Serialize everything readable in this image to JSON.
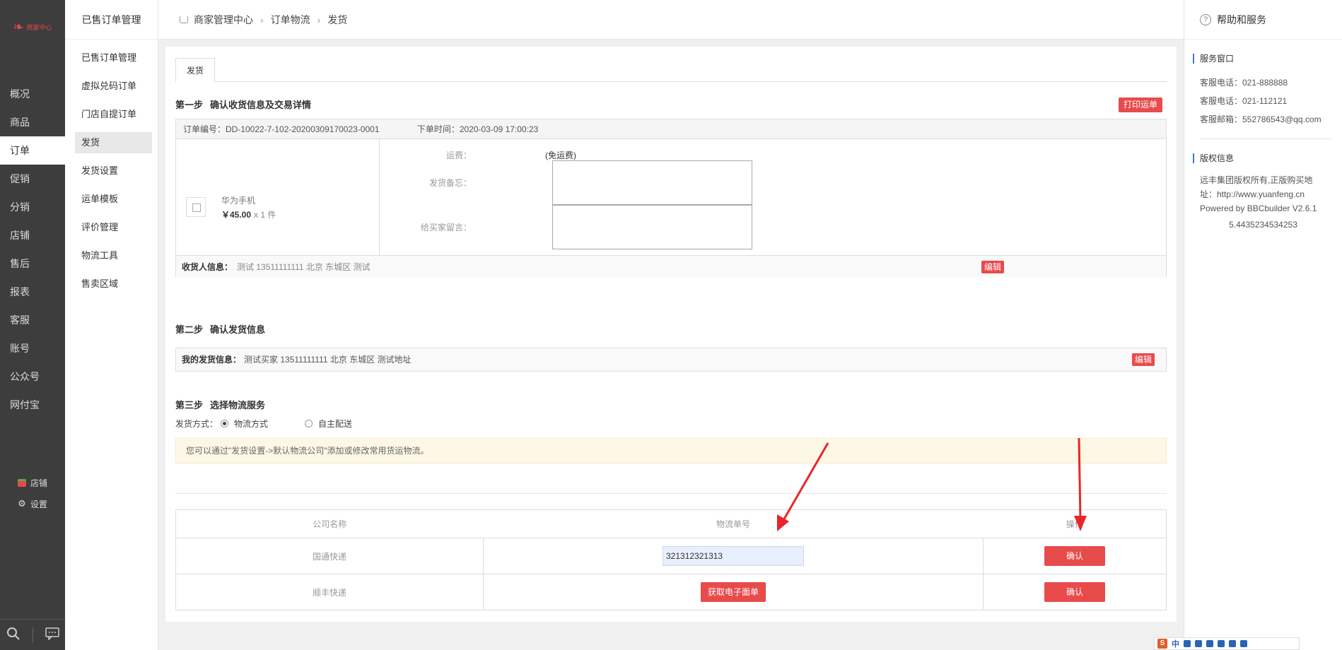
{
  "nav": {
    "logo_text": "商家中心",
    "items": [
      "概况",
      "商品",
      "订单",
      "促销",
      "分销",
      "店铺",
      "售后",
      "报表",
      "客服",
      "账号",
      "公众号",
      "网付宝"
    ],
    "active_index": 2,
    "bottom": {
      "shop": "店铺",
      "settings": "设置"
    }
  },
  "submenu": {
    "title": "已售订单管理",
    "items": [
      "已售订单管理",
      "虚拟兑码订单",
      "门店自提订单",
      "发货",
      "发货设置",
      "运单模板",
      "评价管理",
      "物流工具",
      "售卖区域"
    ],
    "active_index": 3
  },
  "breadcrumb": [
    "商家管理中心",
    "订单物流",
    "发货"
  ],
  "help": {
    "title": "帮助和服务",
    "service_title": "服务窗口",
    "service_lines": [
      "客服电话：021-888888",
      "客服电话：021-112121",
      "客服邮箱：552786543@qq.com"
    ],
    "copyright_title": "版权信息",
    "copyright_lines": [
      "远丰集团版权所有,正版购买地",
      "址：http://www.yuanfeng.cn",
      "Powered by BBCbuilder V2.6.1"
    ],
    "version": "5.4435234534253"
  },
  "main": {
    "tab": "发货",
    "step1": {
      "label": "第一步",
      "title": "确认收货信息及交易详情",
      "print_btn": "打印运单"
    },
    "order": {
      "number_label": "订单编号：DD-10022-7-102-20200309170023-0001",
      "time_label": "下单时间：2020-03-09 17:00:23",
      "product_name": "华为手机",
      "price": "￥45.00",
      "qty": "x 1 件",
      "freight_label": "运费：",
      "freight_value": "(免运费)",
      "memo_label": "发货备忘：",
      "message_label": "给买家留言："
    },
    "receiver": {
      "label": "收货人信息：",
      "value": "测试 13511111111 北京 东城区 测试",
      "edit_btn": "编辑"
    },
    "step2": {
      "label": "第二步",
      "title": "确认发货信息"
    },
    "sender": {
      "label": "我的发货信息：",
      "value": "测试买家 13511111111 北京 东城区 测试地址",
      "edit_btn": "编辑"
    },
    "step3": {
      "label": "第三步",
      "title": "选择物流服务"
    },
    "method": {
      "label": "发货方式：",
      "options": [
        "物流方式",
        "自主配送"
      ],
      "selected": 0
    },
    "notice": "您可以通过\"发货设置->默认物流公司\"添加或修改常用货运物流。",
    "table": {
      "headers": [
        "公司名称",
        "物流单号",
        "操作"
      ],
      "rows": [
        {
          "company": "国通快递",
          "tracking": "321312321313",
          "action": "确认"
        },
        {
          "company": "顺丰快递",
          "button": "获取电子面单",
          "action": "确认"
        }
      ]
    }
  },
  "ime": {
    "badge": "S",
    "chars": "中"
  }
}
